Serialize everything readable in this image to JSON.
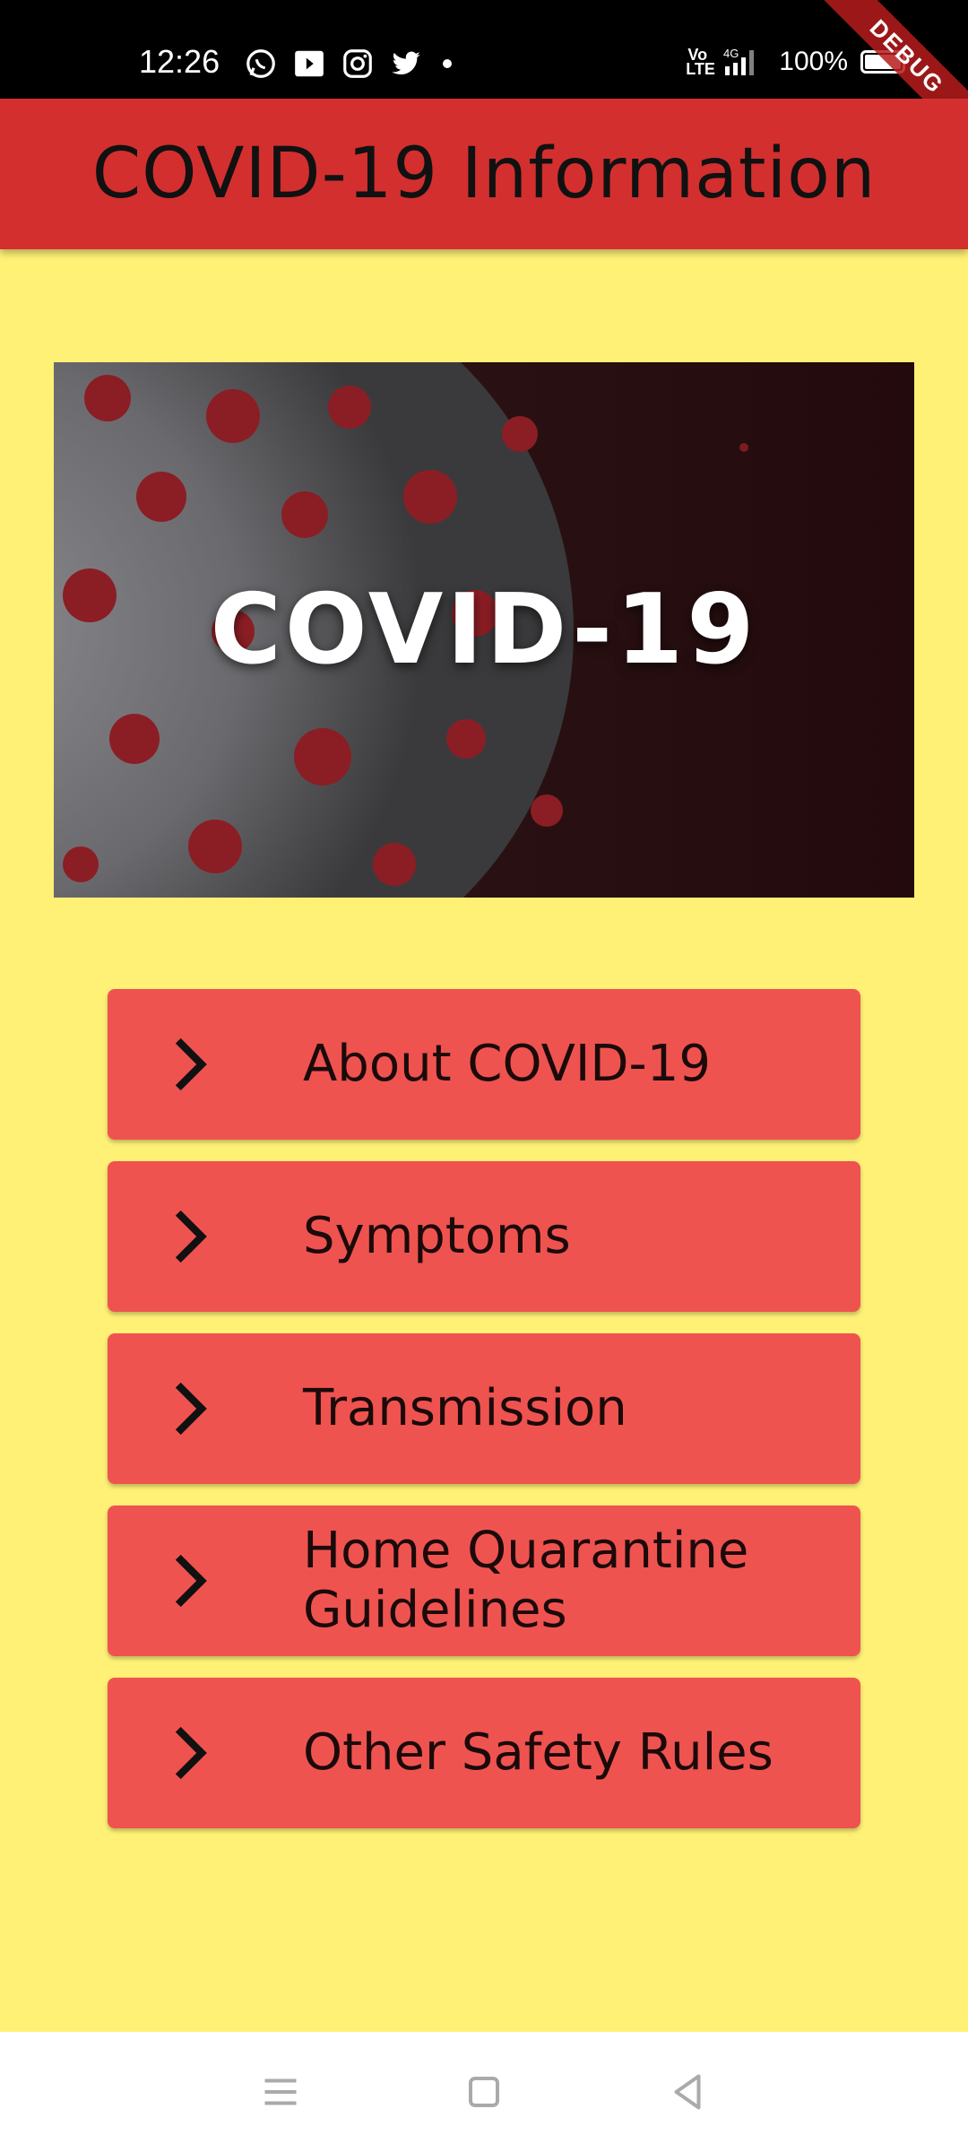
{
  "status_bar": {
    "time": "12:26",
    "notification_icons": [
      "whatsapp-icon",
      "youtube-icon",
      "instagram-icon",
      "twitter-icon",
      "dot-icon"
    ],
    "volte": "Vo\nLTE",
    "network": "4G",
    "battery_percent": "100%"
  },
  "debug_banner": "DEBUG",
  "app_bar": {
    "title": "COVID-19 Information",
    "background": "#d32f2f"
  },
  "banner": {
    "text": "COVID-19"
  },
  "menu": {
    "items": [
      {
        "label": "About COVID-19",
        "icon": "chevron-right-icon"
      },
      {
        "label": "Symptoms",
        "icon": "chevron-right-icon"
      },
      {
        "label": "Transmission",
        "icon": "chevron-right-icon"
      },
      {
        "label": "Home Quarantine Guidelines",
        "icon": "chevron-right-icon"
      },
      {
        "label": "Other Safety Rules",
        "icon": "chevron-right-icon"
      }
    ],
    "button_color": "#ef5350"
  },
  "colors": {
    "page_background": "#fff176",
    "accent": "#d32f2f"
  },
  "nav_bar": {
    "buttons": [
      "menu-icon",
      "home-icon",
      "back-icon"
    ]
  }
}
